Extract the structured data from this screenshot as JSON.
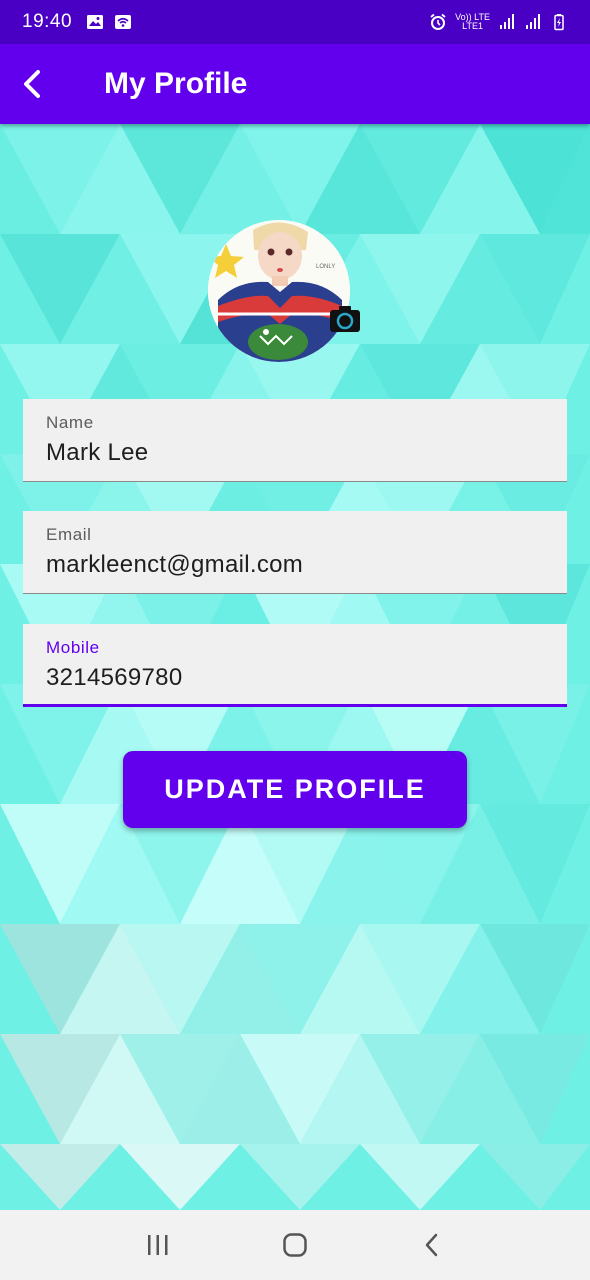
{
  "status_bar": {
    "time": "19:40",
    "network_label_top": "Vo)) LTE",
    "network_label_bottom": "LTE1",
    "icons": [
      "image-icon",
      "wifi-icon",
      "alarm-icon",
      "signal-icon",
      "signal-icon",
      "battery-charging-icon"
    ]
  },
  "app_bar": {
    "back_icon": "arrow-back-icon",
    "title": "My Profile"
  },
  "profile": {
    "avatar_icon": "avatar-image",
    "camera_icon": "camera-icon"
  },
  "form": {
    "name_label": "Name",
    "name_value": "Mark Lee",
    "email_label": "Email",
    "email_value": "markleenct@gmail.com",
    "mobile_label": "Mobile",
    "mobile_value": "3214569780"
  },
  "actions": {
    "update_label": "UPDATE PROFILE"
  },
  "nav_bar": {
    "icons": [
      "recents-icon",
      "home-icon",
      "back-icon"
    ]
  },
  "colors": {
    "primary": "#6200ee",
    "primary_dark": "#4a00c4",
    "background_teal": "#6ff0e4",
    "field_bg": "#f0f0f0"
  }
}
